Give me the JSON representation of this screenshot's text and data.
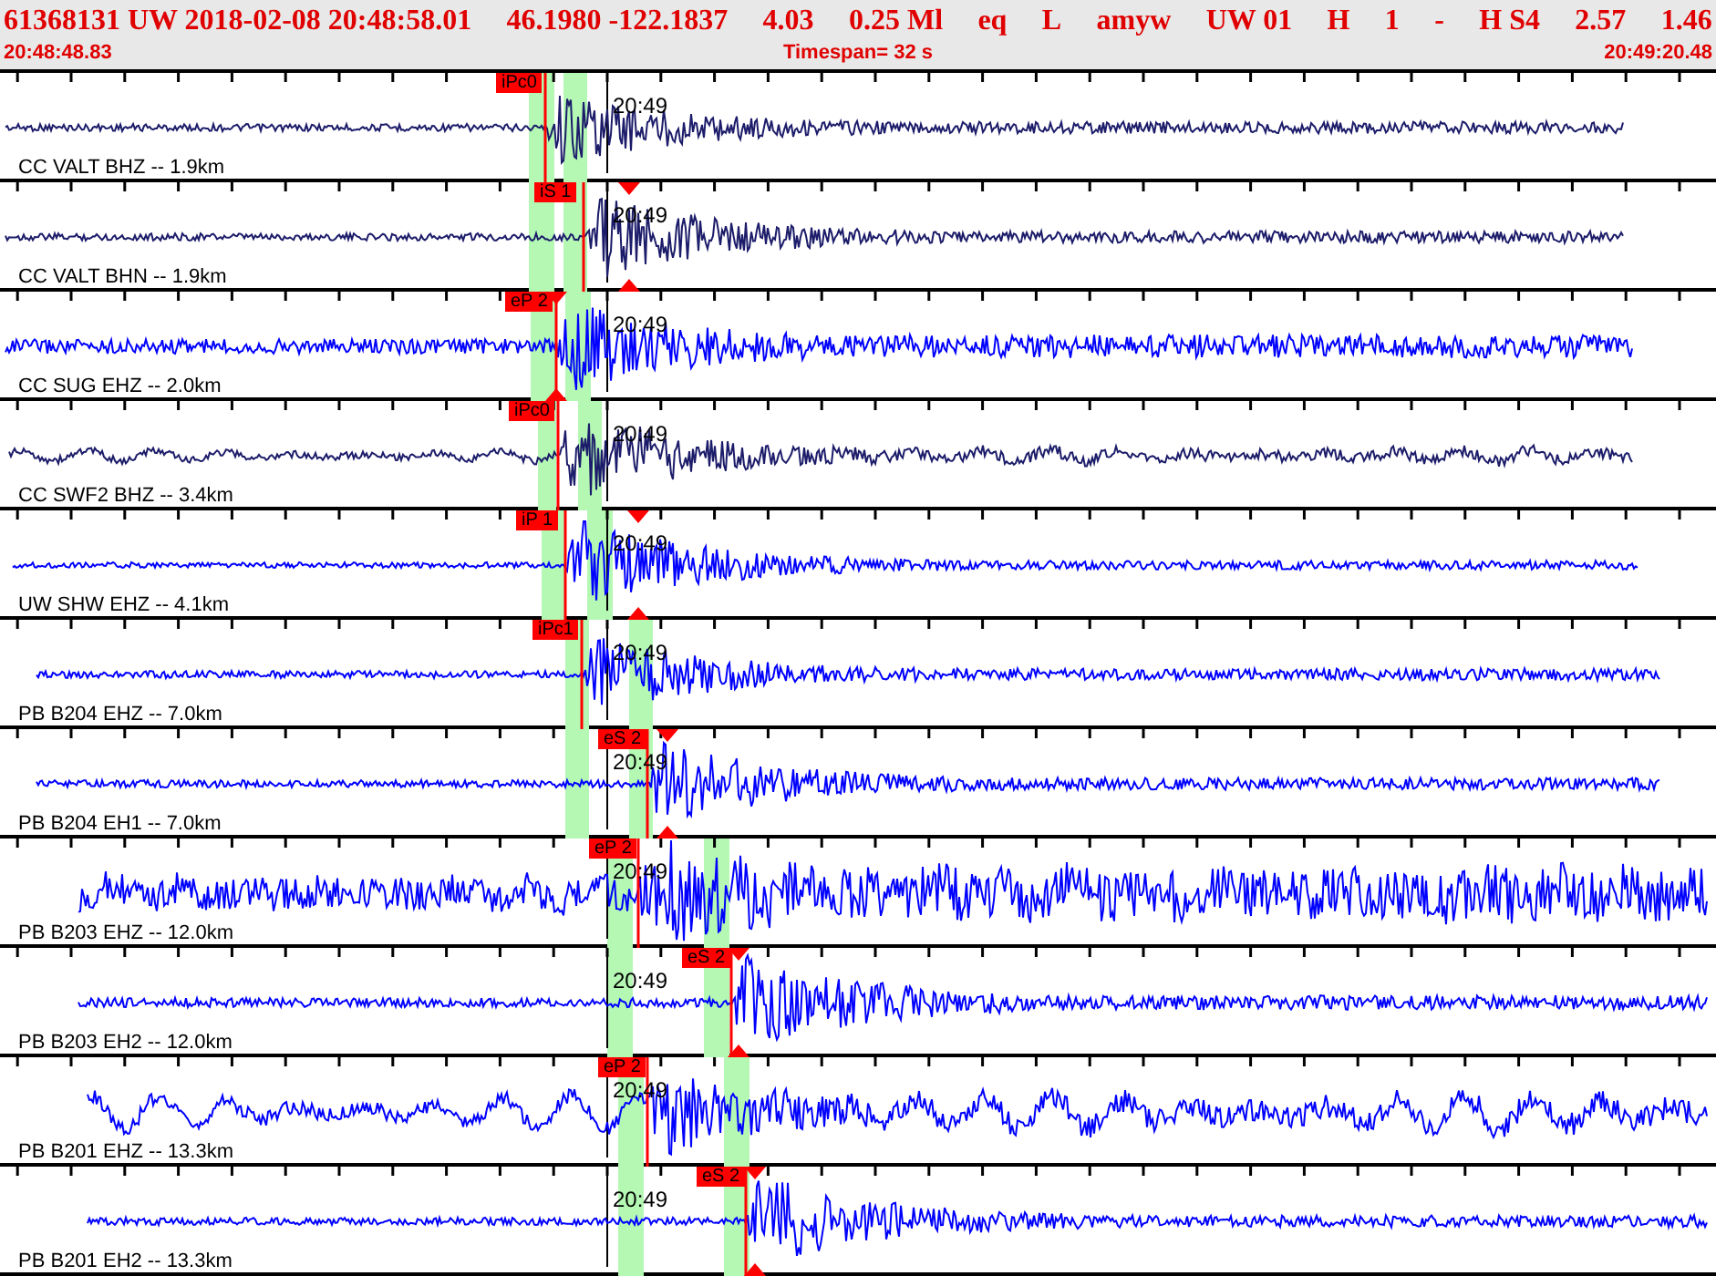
{
  "header": {
    "fields": [
      "61368131 UW 2018-02-08 20:48:58.01",
      "46.1980 -122.1837",
      "4.03",
      "0.25 Ml",
      "eq",
      "L",
      "amyw",
      "UW 01",
      "H",
      "1",
      "-",
      "H S4",
      "2.57",
      "1.46"
    ],
    "start_time": "20:48:48.83",
    "timespan": "Timespan=  32 s",
    "end_time": "20:49:20.48"
  },
  "traces": [
    {
      "label": "CC VALT BHZ -- 1.9km",
      "color": "#1c1c6a",
      "pick": "iPc0",
      "time_mark": "20:49"
    },
    {
      "label": "CC VALT BHN -- 1.9km",
      "color": "#1c1c6a",
      "pick": "iS 1",
      "time_mark": "20:49"
    },
    {
      "label": "CC SUG EHZ -- 2.0km",
      "color": "#0000ff",
      "pick": "eP 2",
      "time_mark": "20:49"
    },
    {
      "label": "CC SWF2 BHZ -- 3.4km",
      "color": "#1c1c6a",
      "pick": "iPc0",
      "time_mark": "20:49"
    },
    {
      "label": "UW SHW EHZ -- 4.1km",
      "color": "#0000ff",
      "pick": "iP 1",
      "time_mark": "20:49"
    },
    {
      "label": "PB B204 EHZ -- 7.0km",
      "color": "#0000ff",
      "pick": "iPc1",
      "time_mark": "20:49"
    },
    {
      "label": "PB B204 EH1 -- 7.0km",
      "color": "#0000ff",
      "pick": "eS 2",
      "time_mark": "20:49"
    },
    {
      "label": "PB B203 EHZ -- 12.0km",
      "color": "#0000ff",
      "pick": "eP 2",
      "time_mark": "20:49"
    },
    {
      "label": "PB B203 EH2 -- 12.0km",
      "color": "#0000ff",
      "pick": "eS 2",
      "time_mark": "20:49"
    },
    {
      "label": "PB B201 EHZ -- 13.3km",
      "color": "#0000ff",
      "pick": "eP 2",
      "time_mark": "20:49"
    },
    {
      "label": "PB B201 EH2 -- 13.3km",
      "color": "#0000ff",
      "pick": "eS 2",
      "time_mark": "20:49"
    }
  ]
}
